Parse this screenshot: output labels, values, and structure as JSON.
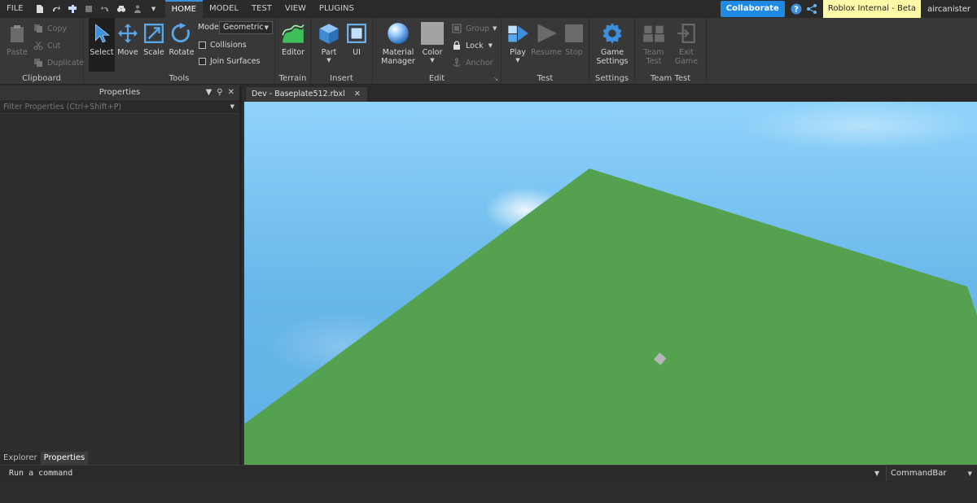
{
  "menubar": {
    "file": "FILE",
    "tabs": [
      "HOME",
      "MODEL",
      "TEST",
      "VIEW",
      "PLUGINS"
    ],
    "collaborate": "Collaborate",
    "beta_badge": "Roblox Internal - Beta",
    "user": "aircanister"
  },
  "ribbon": {
    "clipboard": {
      "label": "Clipboard",
      "paste": "Paste",
      "copy": "Copy",
      "cut": "Cut",
      "duplicate": "Duplicate"
    },
    "tools": {
      "label": "Tools",
      "select": "Select",
      "move": "Move",
      "scale": "Scale",
      "rotate": "Rotate",
      "mode_label": "Mode:",
      "mode_value": "Geometric",
      "collisions": "Collisions",
      "join_surfaces": "Join Surfaces"
    },
    "terrain": {
      "label": "Terrain",
      "editor": "Editor"
    },
    "insert": {
      "label": "Insert",
      "part": "Part",
      "ui": "UI"
    },
    "edit": {
      "label": "Edit",
      "material_manager_1": "Material",
      "material_manager_2": "Manager",
      "color": "Color",
      "group": "Group",
      "lock": "Lock",
      "anchor": "Anchor"
    },
    "test": {
      "label": "Test",
      "play": "Play",
      "resume": "Resume",
      "stop": "Stop"
    },
    "settings": {
      "label": "Settings",
      "game_settings_1": "Game",
      "game_settings_2": "Settings"
    },
    "team_test": {
      "label": "Team Test",
      "team_test_1": "Team",
      "team_test_2": "Test",
      "exit_game_1": "Exit",
      "exit_game_2": "Game"
    }
  },
  "properties": {
    "title": "Properties",
    "filter_placeholder": "Filter Properties (Ctrl+Shift+P)",
    "tabs": [
      "Explorer",
      "Properties"
    ]
  },
  "document": {
    "tab": "Dev - Baseplate512.rbxl"
  },
  "commandbar": {
    "placeholder": "Run a command",
    "select_value": "CommandBar"
  },
  "colors": {
    "accent": "#1e8ae4",
    "baseplate": "#54a150",
    "sky": "#78c4f0",
    "beta_badge": "#fff9a8"
  }
}
